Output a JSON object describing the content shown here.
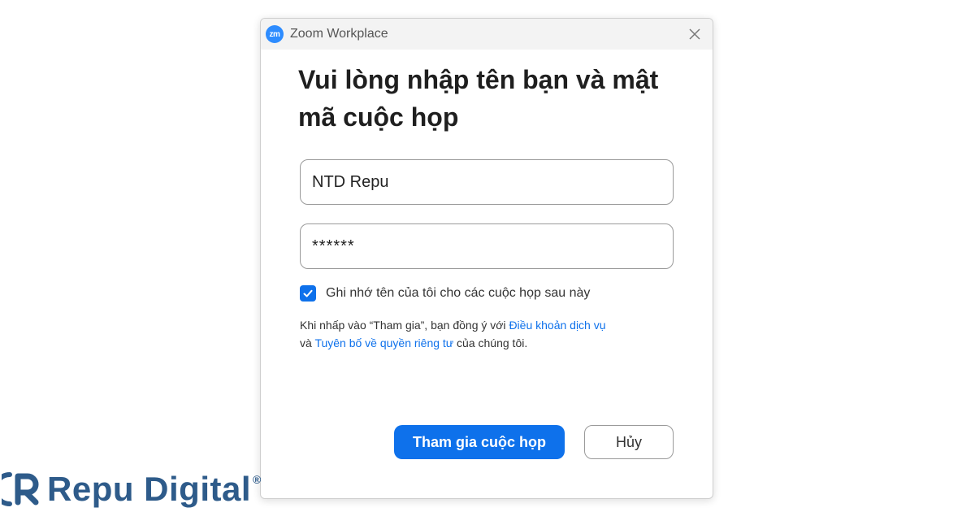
{
  "window": {
    "app_icon_text": "zm",
    "title": "Zoom Workplace"
  },
  "dialog": {
    "heading": "Vui lòng nhập tên bạn và mật mã cuộc họp",
    "name_value": "NTD Repu",
    "passcode_value": "******",
    "remember_checked": true,
    "remember_label": "Ghi nhớ tên của tôi cho các cuộc họp sau này",
    "terms": {
      "prefix": "Khi nhấp vào “Tham gia”, bạn đồng ý với ",
      "tos_link": "Điều khoản dịch vụ",
      "middle": " và ",
      "privacy_link": "Tuyên bố về quyền riêng tư",
      "suffix": " của chúng tôi."
    },
    "join_button": "Tham gia cuộc họp",
    "cancel_button": "Hủy"
  },
  "brand": {
    "name": "Repu Digital",
    "reg_mark": "®"
  },
  "icons": {
    "close": "close-icon",
    "check": "checkmark-icon",
    "logo": "repu-digital-logo-icon"
  },
  "colors": {
    "accent": "#0e71eb",
    "app_icon": "#2d8cff",
    "brand": "#2e5b8a"
  }
}
